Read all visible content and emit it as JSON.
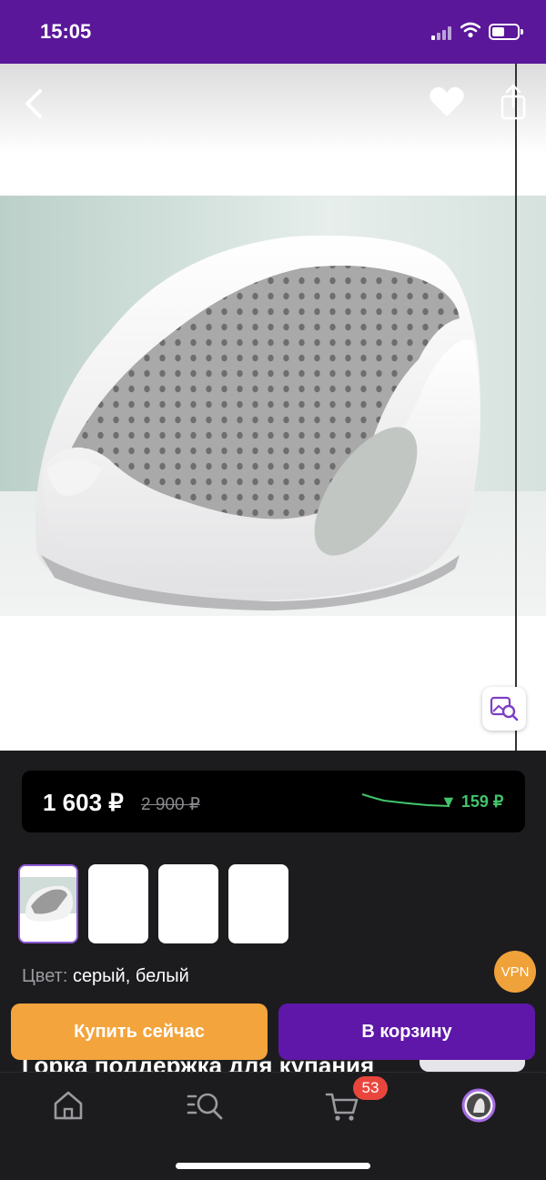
{
  "status_bar": {
    "time": "15:05",
    "icons": [
      "signal-icon",
      "wifi-icon",
      "battery-icon"
    ]
  },
  "gallery": {
    "icons": [
      "chevron-left-icon",
      "heart-icon",
      "share-icon",
      "image-search-icon"
    ],
    "thumbnail_count": 4,
    "selected_thumbnail": 1
  },
  "price": {
    "current": "1 603 ₽",
    "old": "2 900 ₽",
    "drop": "▼ 159 ₽",
    "drop_color": "#42c46a"
  },
  "product": {
    "color_label": "Цвет:",
    "color_value": "серый, белый",
    "title": "Горка поддержка для купания"
  },
  "vpn_badge": "VPN",
  "actions": {
    "buy_now": "Купить сейчас",
    "add_to_cart": "В корзину"
  },
  "tab_bar": {
    "tabs": [
      "home-icon",
      "catalog-search-icon",
      "cart-icon",
      "profile-avatar"
    ],
    "cart_count": "53"
  },
  "colors": {
    "brand_purple": "#5a1799",
    "buy_orange": "#f3a43d",
    "cart_badge": "#e8463d"
  }
}
